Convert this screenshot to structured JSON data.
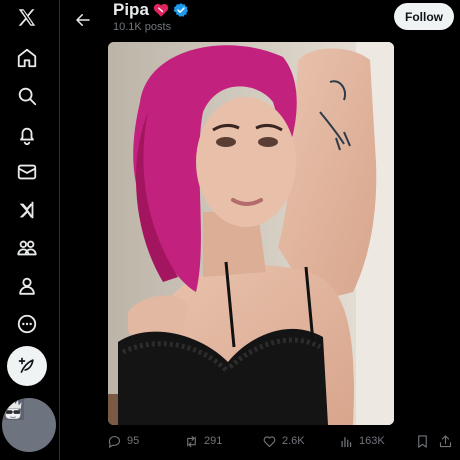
{
  "nav": {
    "items": [
      {
        "name": "x-logo-icon"
      },
      {
        "name": "home-icon"
      },
      {
        "name": "search-icon"
      },
      {
        "name": "notifications-icon"
      },
      {
        "name": "messages-icon"
      },
      {
        "name": "grok-icon"
      },
      {
        "name": "communities-icon"
      },
      {
        "name": "profile-icon"
      },
      {
        "name": "more-icon"
      }
    ],
    "compose_icon": "feather-plus-icon"
  },
  "header": {
    "name": "Pipa",
    "posts_count": "10.1K posts",
    "follow_label": "Follow"
  },
  "actions": {
    "replies": "95",
    "reposts": "291",
    "likes": "2.6K",
    "views": "163K"
  },
  "colors": {
    "background": "#000000",
    "text": "#e7e9ea",
    "muted": "#71767b",
    "verified": "#1d9bf0",
    "heart": "#f91880",
    "follow_bg": "#eff3f4"
  }
}
